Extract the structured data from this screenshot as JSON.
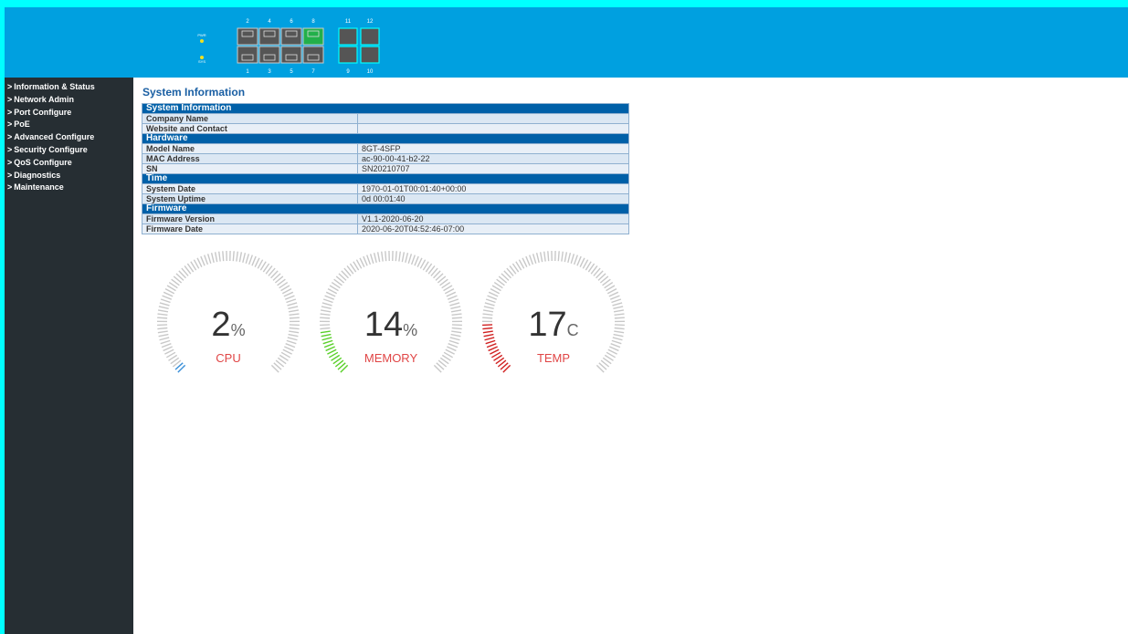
{
  "header": {
    "leds": [
      {
        "label": "PWR",
        "color": "#f0e020"
      },
      {
        "label": "SYS",
        "color": "#f0e020"
      }
    ],
    "ports_top": [
      "2",
      "4",
      "6",
      "8"
    ],
    "ports_bottom": [
      "1",
      "3",
      "5",
      "7"
    ],
    "sfp_top": [
      "11",
      "12"
    ],
    "sfp_bottom": [
      "9",
      "10"
    ],
    "active_port": "8",
    "active_color": "#22b04a"
  },
  "sidebar": {
    "items": [
      {
        "label": "Information & Status"
      },
      {
        "label": "Network Admin"
      },
      {
        "label": "Port Configure"
      },
      {
        "label": "PoE"
      },
      {
        "label": "Advanced Configure"
      },
      {
        "label": "Security Configure"
      },
      {
        "label": "QoS Configure"
      },
      {
        "label": "Diagnostics"
      },
      {
        "label": "Maintenance"
      }
    ]
  },
  "main": {
    "title": "System Information",
    "sections": [
      {
        "title": "System Information",
        "rows": [
          {
            "k": "Company Name",
            "v": ""
          },
          {
            "k": "Website and Contact",
            "v": ""
          }
        ]
      },
      {
        "title": "Hardware",
        "rows": [
          {
            "k": "Model Name",
            "v": "8GT-4SFP"
          },
          {
            "k": "MAC Address",
            "v": "ac-90-00-41-b2-22"
          },
          {
            "k": "SN",
            "v": "SN20210707"
          }
        ]
      },
      {
        "title": "Time",
        "rows": [
          {
            "k": "System Date",
            "v": "1970-01-01T00:01:40+00:00"
          },
          {
            "k": "System Uptime",
            "v": "0d 00:01:40"
          }
        ]
      },
      {
        "title": "Firmware",
        "rows": [
          {
            "k": "Firmware Version",
            "v": "V1.1-2020-06-20"
          },
          {
            "k": "Firmware Date",
            "v": "2020-06-20T04:52:46-07:00"
          }
        ]
      }
    ],
    "gauges": [
      {
        "value": "2",
        "unit": "%",
        "label": "CPU",
        "level": 0.02,
        "color": "#3a8fd8"
      },
      {
        "value": "14",
        "unit": "%",
        "label": "MEMORY",
        "level": 0.14,
        "color": "#5ad02a"
      },
      {
        "value": "17",
        "unit": "C",
        "label": "TEMP",
        "level": 0.17,
        "color": "#d02020"
      }
    ]
  }
}
